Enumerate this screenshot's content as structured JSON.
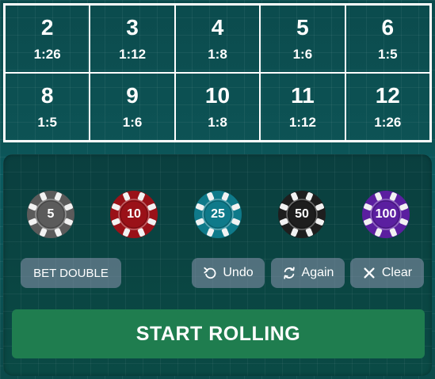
{
  "bet_board": {
    "cells": [
      {
        "number": "2",
        "odds": "1:26"
      },
      {
        "number": "3",
        "odds": "1:12"
      },
      {
        "number": "4",
        "odds": "1:8"
      },
      {
        "number": "5",
        "odds": "1:6"
      },
      {
        "number": "6",
        "odds": "1:5"
      },
      {
        "number": "8",
        "odds": "1:5"
      },
      {
        "number": "9",
        "odds": "1:6"
      },
      {
        "number": "10",
        "odds": "1:8"
      },
      {
        "number": "11",
        "odds": "1:12"
      },
      {
        "number": "12",
        "odds": "1:26"
      }
    ]
  },
  "chips": [
    {
      "value": "5",
      "color": "#5b5b5b"
    },
    {
      "value": "10",
      "color": "#9a1118"
    },
    {
      "value": "25",
      "color": "#0f7a8a"
    },
    {
      "value": "50",
      "color": "#1e1e1e"
    },
    {
      "value": "100",
      "color": "#5b1fa0"
    }
  ],
  "controls": {
    "double_label": "BET DOUBLE",
    "undo_label": "Undo",
    "again_label": "Again",
    "clear_label": "Clear",
    "start_label": "START ROLLING"
  },
  "colors": {
    "start_button": "#1f7d4f",
    "secondary_button": "#8c96af"
  }
}
